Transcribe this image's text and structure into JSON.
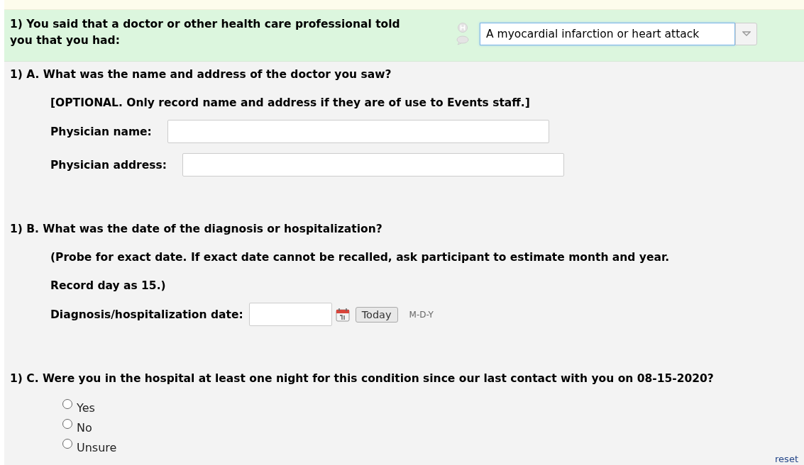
{
  "header": {
    "question": "1) You said that a doctor or other health care professional told you that you had:",
    "answer": "A myocardial infarction or heart attack"
  },
  "items": [
    {
      "kind": "question",
      "text": "1) A. What was the name and address of the doctor you saw?"
    },
    {
      "kind": "note",
      "text": "[OPTIONAL. Only record name and address if they are of use to Events staff.]"
    },
    {
      "kind": "field",
      "label": "Physician name:"
    },
    {
      "kind": "field",
      "label": "Physician address:"
    },
    {
      "kind": "gap"
    },
    {
      "kind": "question",
      "text": "1) B. What was the date of the diagnosis or hospitalization?"
    },
    {
      "kind": "note",
      "text": "(Probe for exact date. If exact date cannot be recalled, ask participant to estimate month and year."
    },
    {
      "kind": "note",
      "text": "Record day as 15.)"
    },
    {
      "kind": "date",
      "label": "Diagnosis/hospitalization date:",
      "button": "Today",
      "format": "M-D-Y"
    },
    {
      "kind": "gap"
    },
    {
      "kind": "question",
      "text": "1) C. Were you in the hospital at least one night for this condition since our last contact with you on 08-15-2020?"
    },
    {
      "kind": "radios",
      "options": [
        {
          "label": "Yes",
          "selected": false
        },
        {
          "label": "No",
          "selected": false
        },
        {
          "label": "Unsure",
          "selected": false
        }
      ],
      "reset": "reset"
    }
  ]
}
